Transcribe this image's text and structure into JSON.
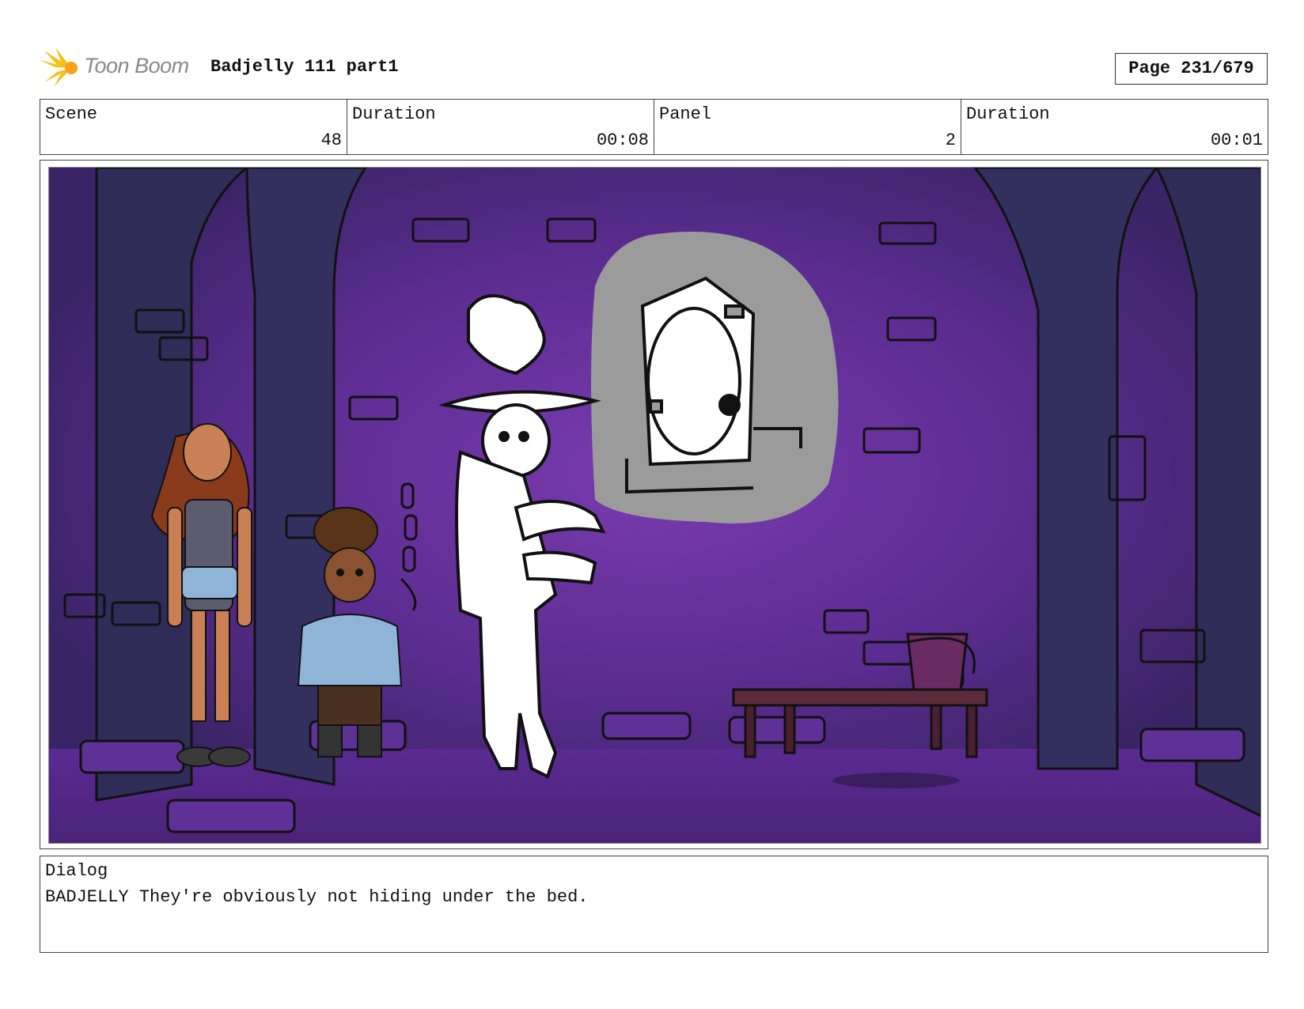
{
  "header": {
    "logo_text": "Toon Boom",
    "project_title": "Badjelly 111 part1",
    "page_label": "Page 231/679"
  },
  "info": {
    "scene_label": "Scene",
    "scene_value": "48",
    "scene_duration_label": "Duration",
    "scene_duration_value": "00:08",
    "panel_label": "Panel",
    "panel_value": "2",
    "panel_duration_label": "Duration",
    "panel_duration_value": "00:01"
  },
  "dialog": {
    "label": "Dialog",
    "text": "BADJELLY They're obviously not hiding under the bed."
  },
  "colors": {
    "wall": "#4a2a78",
    "wall_glow": "#7a3bb0",
    "pillar": "#2e2f55",
    "floor": "#5a2c8f",
    "thought_bubble": "#9b9b9b",
    "logo_yellow": "#f5c018"
  }
}
